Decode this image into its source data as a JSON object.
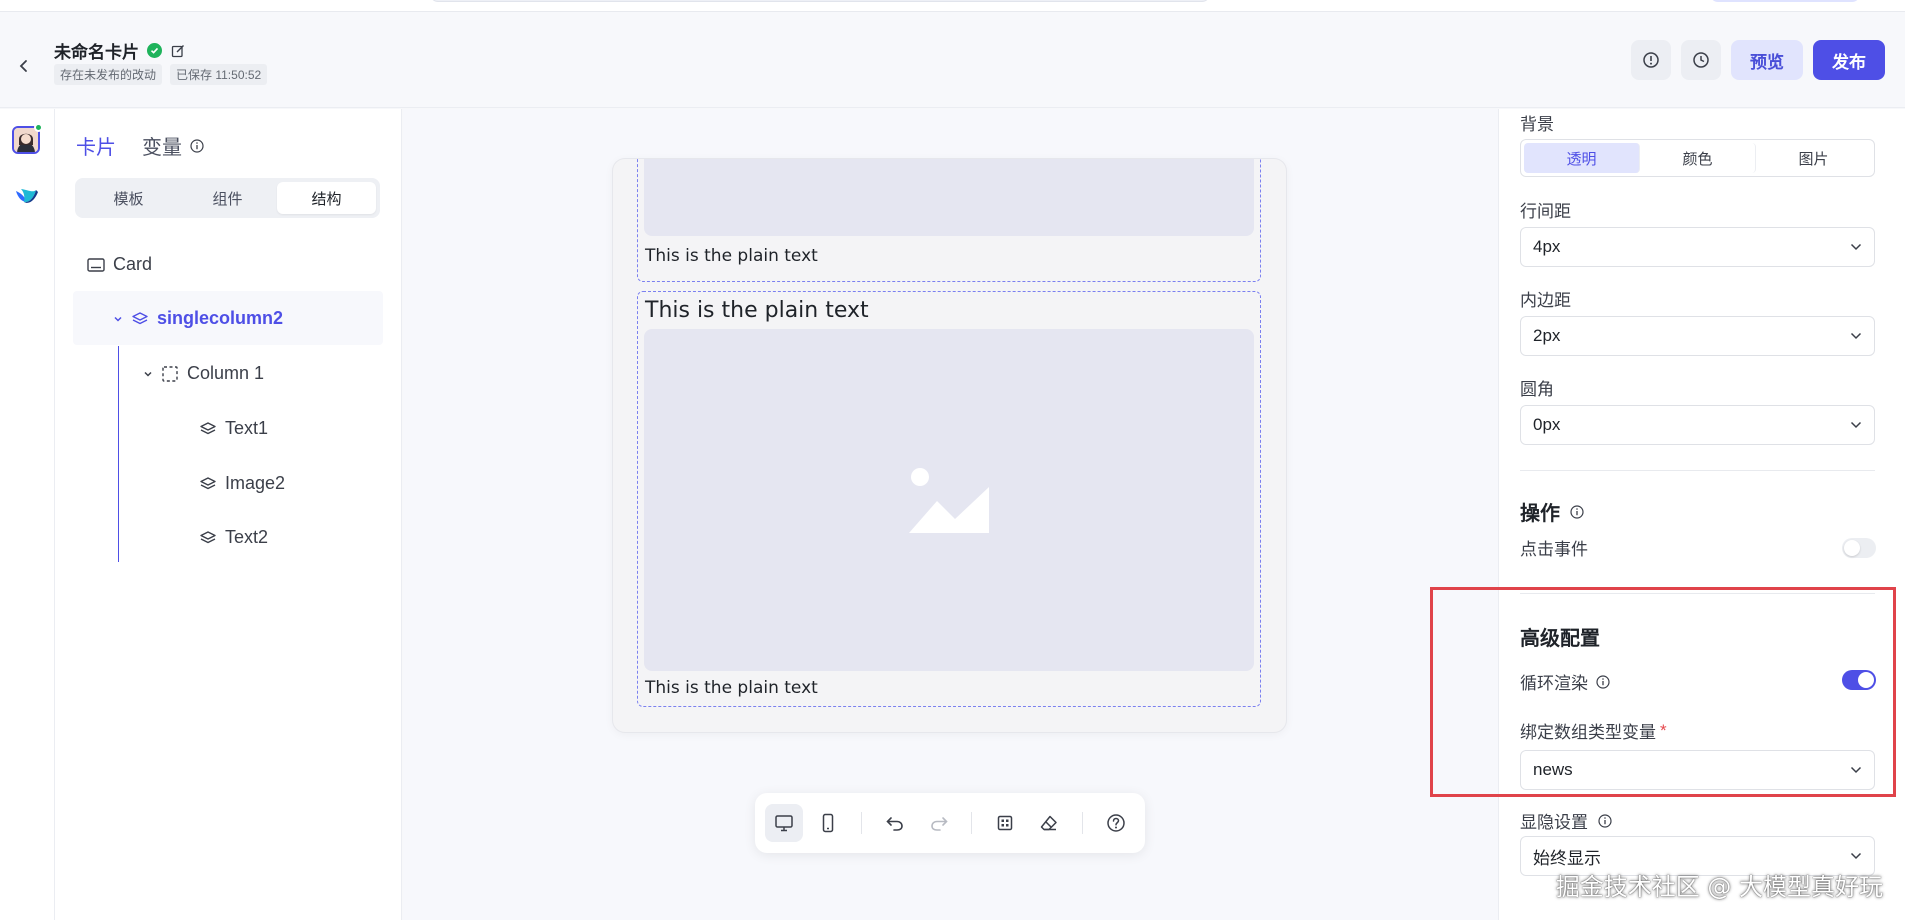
{
  "header": {
    "title": "未命名卡片",
    "unpublished_tag": "存在未发布的改动",
    "saved_tag": "已保存 11:50:52",
    "preview_label": "预览",
    "publish_label": "发布"
  },
  "left_panel": {
    "tabs": [
      {
        "label": "卡片",
        "active": true
      },
      {
        "label": "变量",
        "active": false
      }
    ],
    "segments": [
      {
        "label": "模板",
        "active": false
      },
      {
        "label": "组件",
        "active": false
      },
      {
        "label": "结构",
        "active": true
      }
    ],
    "tree": {
      "root": "Card",
      "container": "singlecolumn2",
      "column": "Column 1",
      "children": [
        "Text1",
        "Image2",
        "Text2"
      ]
    }
  },
  "canvas": {
    "text_a_bottom": "This is the plain text",
    "text_b_top": "This is the plain text",
    "text_b_bottom": "This is the plain text"
  },
  "right_panel": {
    "background_label": "背景",
    "background_options": [
      {
        "label": "透明",
        "active": true
      },
      {
        "label": "颜色",
        "active": false
      },
      {
        "label": "图片",
        "active": false
      }
    ],
    "line_spacing_label": "行间距",
    "line_spacing_value": "4px",
    "padding_label": "内边距",
    "padding_value": "2px",
    "radius_label": "圆角",
    "radius_value": "0px",
    "actions_title": "操作",
    "click_event_label": "点击事件",
    "click_event_enabled": false,
    "advanced_title": "高级配置",
    "loop_render_label": "循环渲染",
    "loop_render_enabled": true,
    "bind_array_label": "绑定数组类型变量",
    "bind_array_value": "news",
    "visibility_label": "显隐设置",
    "visibility_value": "始终显示"
  },
  "watermark": "掘金技术社区 @ 大模型真好玩",
  "colors": {
    "accent": "#4e4fe6",
    "success": "#1eb35b",
    "highlight_border": "#e0434a"
  }
}
